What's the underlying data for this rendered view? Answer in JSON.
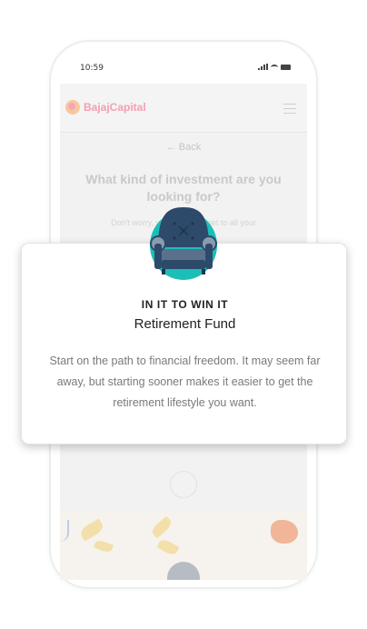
{
  "status_bar": {
    "time": "10:59"
  },
  "header": {
    "brand": "BajajCapital"
  },
  "background_page": {
    "back_label": "← Back",
    "question_title": "What kind of investment are you looking for?",
    "question_subtitle": "Don't worry, we'll help you get to all your"
  },
  "card": {
    "title": "IN IT TO WIN IT",
    "subtitle": "Retirement Fund",
    "description": "Start on the path to financial freedom. It may seem far away, but starting sooner makes it easier to get the retirement lifestyle you want."
  },
  "colors": {
    "accent_teal": "#1bbfb8",
    "armchair_navy": "#2e4a6b",
    "brand_pink": "#f3a0ae"
  },
  "icons": [
    "armchair-illustration",
    "menu-icon",
    "signal-icon",
    "wifi-icon",
    "battery-icon"
  ]
}
